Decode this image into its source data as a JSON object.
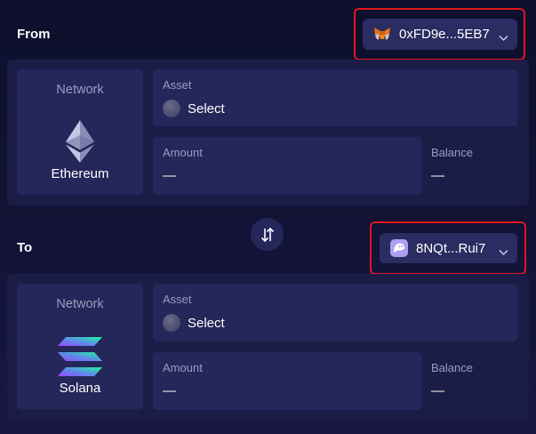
{
  "from": {
    "label": "From",
    "wallet": {
      "address": "0xFD9e...5EB7",
      "icon": "metamask-fox-icon"
    },
    "network": {
      "label": "Network",
      "name": "Ethereum",
      "icon": "ethereum-icon"
    },
    "asset": {
      "label": "Asset",
      "value": "Select"
    },
    "amount": {
      "label": "Amount",
      "value": "—"
    },
    "balance": {
      "label": "Balance",
      "value": "—"
    }
  },
  "to": {
    "label": "To",
    "wallet": {
      "address": "8NQt...Rui7",
      "icon": "phantom-ghost-icon"
    },
    "network": {
      "label": "Network",
      "name": "Solana",
      "icon": "solana-icon"
    },
    "asset": {
      "label": "Asset",
      "value": "Select"
    },
    "amount": {
      "label": "Amount",
      "value": "—"
    },
    "balance": {
      "label": "Balance",
      "value": "—"
    }
  },
  "swap": {
    "icon": "swap-arrows-icon"
  },
  "colors": {
    "background": "#0d0f2d",
    "panel": "#1c1d47",
    "card": "#25265a",
    "wallet_button": "#2b2c62",
    "highlight": "#e0161e",
    "muted_text": "#9b9cbf"
  }
}
